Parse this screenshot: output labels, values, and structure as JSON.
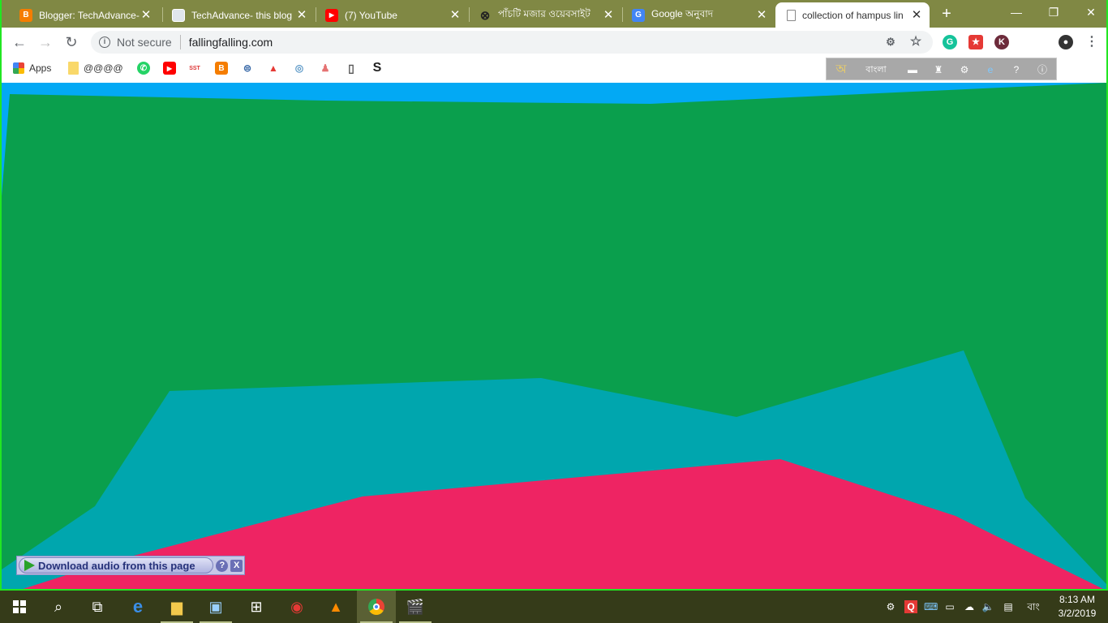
{
  "browser": {
    "tabs": [
      {
        "title": "Blogger: TechAdvance-",
        "icon": "blogger-icon",
        "color": "#f57d00",
        "glyph": "B"
      },
      {
        "title": "TechAdvance- this blog",
        "icon": "page-icon",
        "color": "#e0e6ec",
        "glyph": ""
      },
      {
        "title": "(7) YouTube",
        "icon": "youtube-icon",
        "color": "#ff0000",
        "glyph": "▶"
      },
      {
        "title": "পাঁচটি মজার ওয়েবসাইট",
        "icon": "globe-icon",
        "color": "#808844",
        "glyph": "⊗"
      },
      {
        "title": "Google অনুবাদ",
        "icon": "google-translate-icon",
        "color": "#4285f4",
        "glyph": "G"
      },
      {
        "title": "collection of hampus lin",
        "icon": "document-icon",
        "color": "#ffffff",
        "glyph": ""
      }
    ],
    "close_glyph": "✕",
    "new_tab_glyph": "+",
    "security_label": "Not secure",
    "url": "fallingfalling.com"
  },
  "bookmarks": [
    {
      "label": "Apps",
      "icon": "apps-grid-icon",
      "color": "#ff6a2a",
      "glyph": ""
    },
    {
      "label": "@@@@",
      "icon": "folder-icon",
      "color": "#f9d86a",
      "glyph": ""
    },
    {
      "label": "",
      "icon": "whatsapp-icon",
      "color": "#25d366",
      "glyph": "✆"
    },
    {
      "label": "",
      "icon": "youtube-icon",
      "color": "#ff0000",
      "glyph": "▶"
    },
    {
      "label": "",
      "icon": "sst-icon",
      "color": "#ffffff",
      "glyph": "SST"
    },
    {
      "label": "",
      "icon": "blogger-icon",
      "color": "#f57d00",
      "glyph": "B"
    },
    {
      "label": "",
      "icon": "site-icon",
      "color": "#ffffff",
      "glyph": "⊜"
    },
    {
      "label": "",
      "icon": "flame-icon",
      "color": "#ffffff",
      "glyph": "▲"
    },
    {
      "label": "",
      "icon": "site-round-icon",
      "color": "#ffffff",
      "glyph": "◎"
    },
    {
      "label": "",
      "icon": "people-icon",
      "color": "#ffffff",
      "glyph": "♟"
    },
    {
      "label": "",
      "icon": "page-icon",
      "color": "#ffffff",
      "glyph": "▯"
    },
    {
      "label": "",
      "icon": "s-logo-icon",
      "color": "#ffffff",
      "glyph": "S"
    }
  ],
  "ime_toolbar": {
    "language": "বাংলা",
    "logo_glyph": "অ"
  },
  "scene": {
    "colors": {
      "sky": "#03a9f4",
      "back": "#0a9f4d",
      "middle": "#00a6ae",
      "front": "#ee2463"
    }
  },
  "download_bar": {
    "label": "Download audio from this page",
    "help": "?",
    "close": "X"
  },
  "taskbar": {
    "lang": "বাং",
    "time": "8:13 AM",
    "date": "3/2/2019"
  }
}
